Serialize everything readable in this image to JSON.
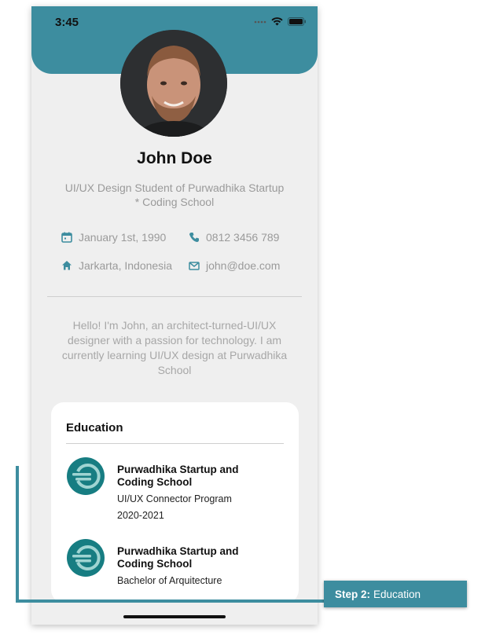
{
  "status": {
    "time": "3:45"
  },
  "profile": {
    "name": "John Doe",
    "subtitle": "UI/UX Design Student of Purwadhika Startup * Coding School",
    "birthday": "January 1st, 1990",
    "phone": "0812 3456 789",
    "location": "Jarkarta, Indonesia",
    "email": "john@doe.com",
    "bio": "Hello! I'm John, an architect-turned-UI/UX designer with a passion for technology. I am currently learning UI/UX design at Purwadhika School"
  },
  "education": {
    "title": "Education",
    "items": [
      {
        "name": "Purwadhika Startup and Coding School",
        "program": "UI/UX Connector Program",
        "years": "2020-2021"
      },
      {
        "name": "Purwadhika Startup and Coding School",
        "program": "Bachelor of Arquitecture",
        "years": ""
      }
    ]
  },
  "callout": {
    "step": "Step 2:",
    "label": "Education"
  },
  "colors": {
    "accent": "#3d8d9f",
    "logo": "#177d82",
    "muted_text": "#9a9a9a"
  },
  "icons": [
    "calendar-icon",
    "phone-icon",
    "home-icon",
    "mail-icon",
    "wifi-icon",
    "battery-icon",
    "signal-icon"
  ]
}
